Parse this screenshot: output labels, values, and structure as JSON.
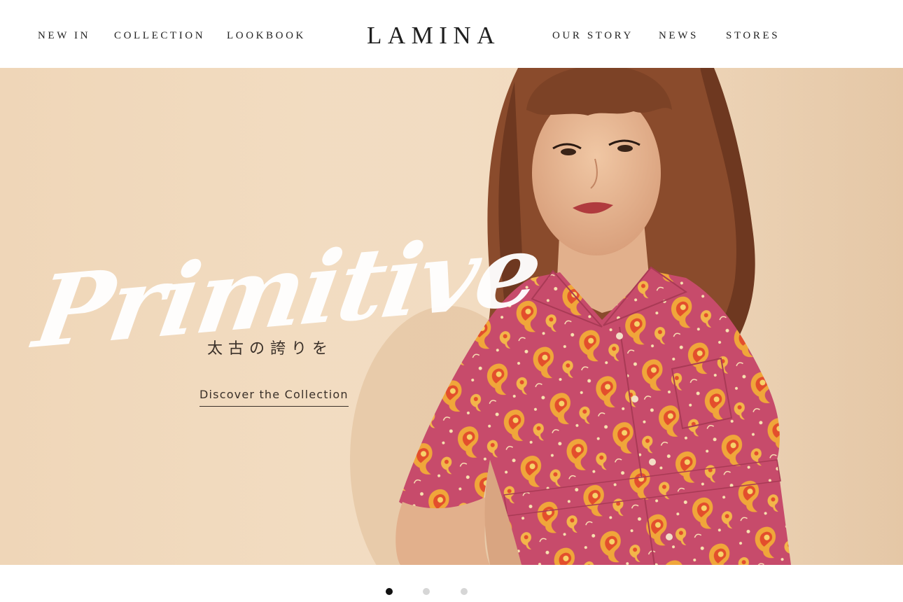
{
  "header": {
    "logo": "LAMINA",
    "nav_left": [
      "NEW IN",
      "COLLECTION",
      "LOOKBOOK"
    ],
    "nav_right": [
      "OUR STORY",
      "NEWS",
      "STORES"
    ]
  },
  "hero": {
    "script_title": "Primitive",
    "subtitle_jp": "太古の誇りを",
    "cta_label": "Discover the Collection"
  },
  "carousel": {
    "slide_count": 3,
    "active_index": 0
  },
  "colors": {
    "background": "#f2dcc1",
    "shirt": "#c74b6b",
    "paisley": "#f0a63a",
    "text_dark": "#222222",
    "dot_active": "#111111",
    "dot_inactive": "#d6d6d6"
  }
}
